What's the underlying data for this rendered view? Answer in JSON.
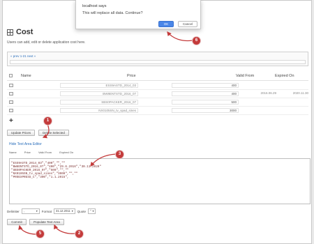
{
  "dialog": {
    "title": "localhost says",
    "message": "This will replace all data. Continue?",
    "ok_label": "OK",
    "cancel_label": "Cancel"
  },
  "page": {
    "title": "Cost",
    "subtitle": "Users can add, edit or delete application cost here."
  },
  "pager": {
    "text": "« prev 1-21 next »"
  },
  "table": {
    "headers": {
      "name": "Name",
      "price": "Price",
      "valid_from": "Valid From",
      "expired_on": "Expired On"
    },
    "rows": [
      {
        "name": "ESS9ASTD_2014_03",
        "price": "400",
        "valid_from": "",
        "expired_on": ""
      },
      {
        "name": "BW8ENTSTD_2016_07",
        "price": "400",
        "valid_from": "2016.06.29",
        "expired_on": "2020.11.30"
      },
      {
        "name": "SBS0PACKER_2016_07",
        "price": "500",
        "valid_from": "",
        "expired_on": ""
      },
      {
        "name": "NX0105SN_tv_spad_sines",
        "price": "3000",
        "valid_from": "",
        "expired_on": ""
      }
    ]
  },
  "buttons": {
    "update_prices": "Update Prices",
    "delete_selected": "Delete Selected",
    "commit": "Commit",
    "populate_text_area": "Populate Text Area"
  },
  "editor": {
    "toggle_link": "Hide Text Area Editor",
    "columns": [
      "Name",
      "Price",
      "Valid From",
      "Expired On"
    ],
    "lines": [
      "\"ESS9ASTD_2014_03\",\"400\",\"\",\"\"",
      "\"BW8ENTSTD_2016_07\",\"400\",\"29.6.2016\",\"30.11.2020\"",
      "\"SBS0PACKER_2016_07\",\"500\",\"\",\"\"",
      "\"NX0105SN_tv_spad_sines\",\"3000\",\"\",\"\"",
      "\"PROEXPRESS_C\",\"300\",\"1.1.2015\","
    ]
  },
  "format_bar": {
    "delimiter_label": "Delimiter",
    "delimiter_value": ",",
    "format_label": "Format",
    "format_value": "31.12.2011",
    "quote_label": "Quote",
    "quote_value": "\""
  },
  "markers": [
    "1",
    "2",
    "3",
    "4",
    "5",
    "6"
  ],
  "colors": {
    "link": "#2a6ebb",
    "marker": "#c43b3b",
    "dialog_ok": "#4a86e8"
  }
}
